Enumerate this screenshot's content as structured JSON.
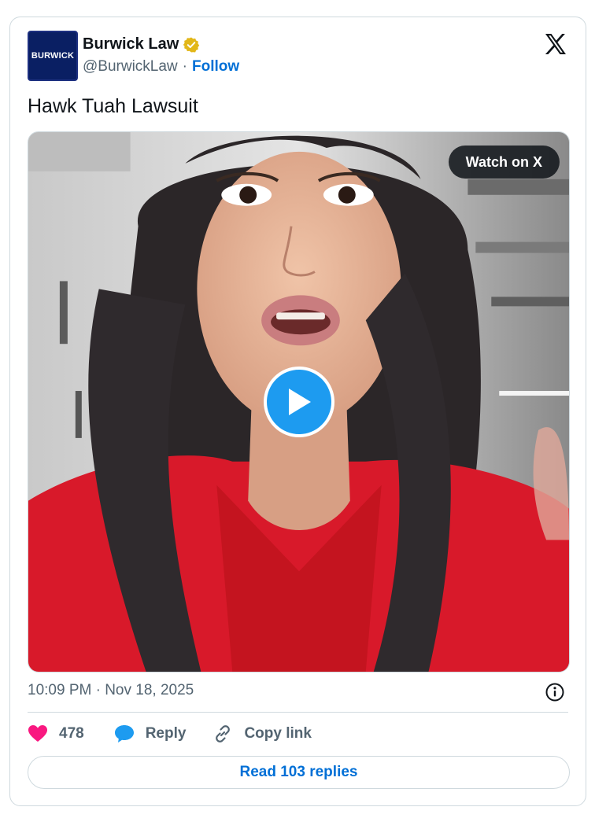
{
  "author": {
    "avatar_text": "BURWICK",
    "display_name": "Burwick Law",
    "handle": "@BurwickLaw",
    "separator": "·",
    "follow_label": "Follow",
    "verified": true
  },
  "tweet": {
    "text": "Hawk Tuah Lawsuit",
    "timestamp": "10:09 PM · Nov 18, 2025"
  },
  "media": {
    "watch_label": "Watch on X"
  },
  "actions": {
    "like_count": "478",
    "reply_label": "Reply",
    "copy_link_label": "Copy link"
  },
  "read_replies_label": "Read 103 replies",
  "colors": {
    "link_blue": "#006fd6",
    "play_blue": "#1d9bf0",
    "heart_pink": "#f91880",
    "muted": "#536471"
  },
  "icons": [
    "verified-badge-icon",
    "x-logo-icon",
    "play-icon",
    "info-icon",
    "heart-icon",
    "reply-bubble-icon",
    "link-icon"
  ]
}
